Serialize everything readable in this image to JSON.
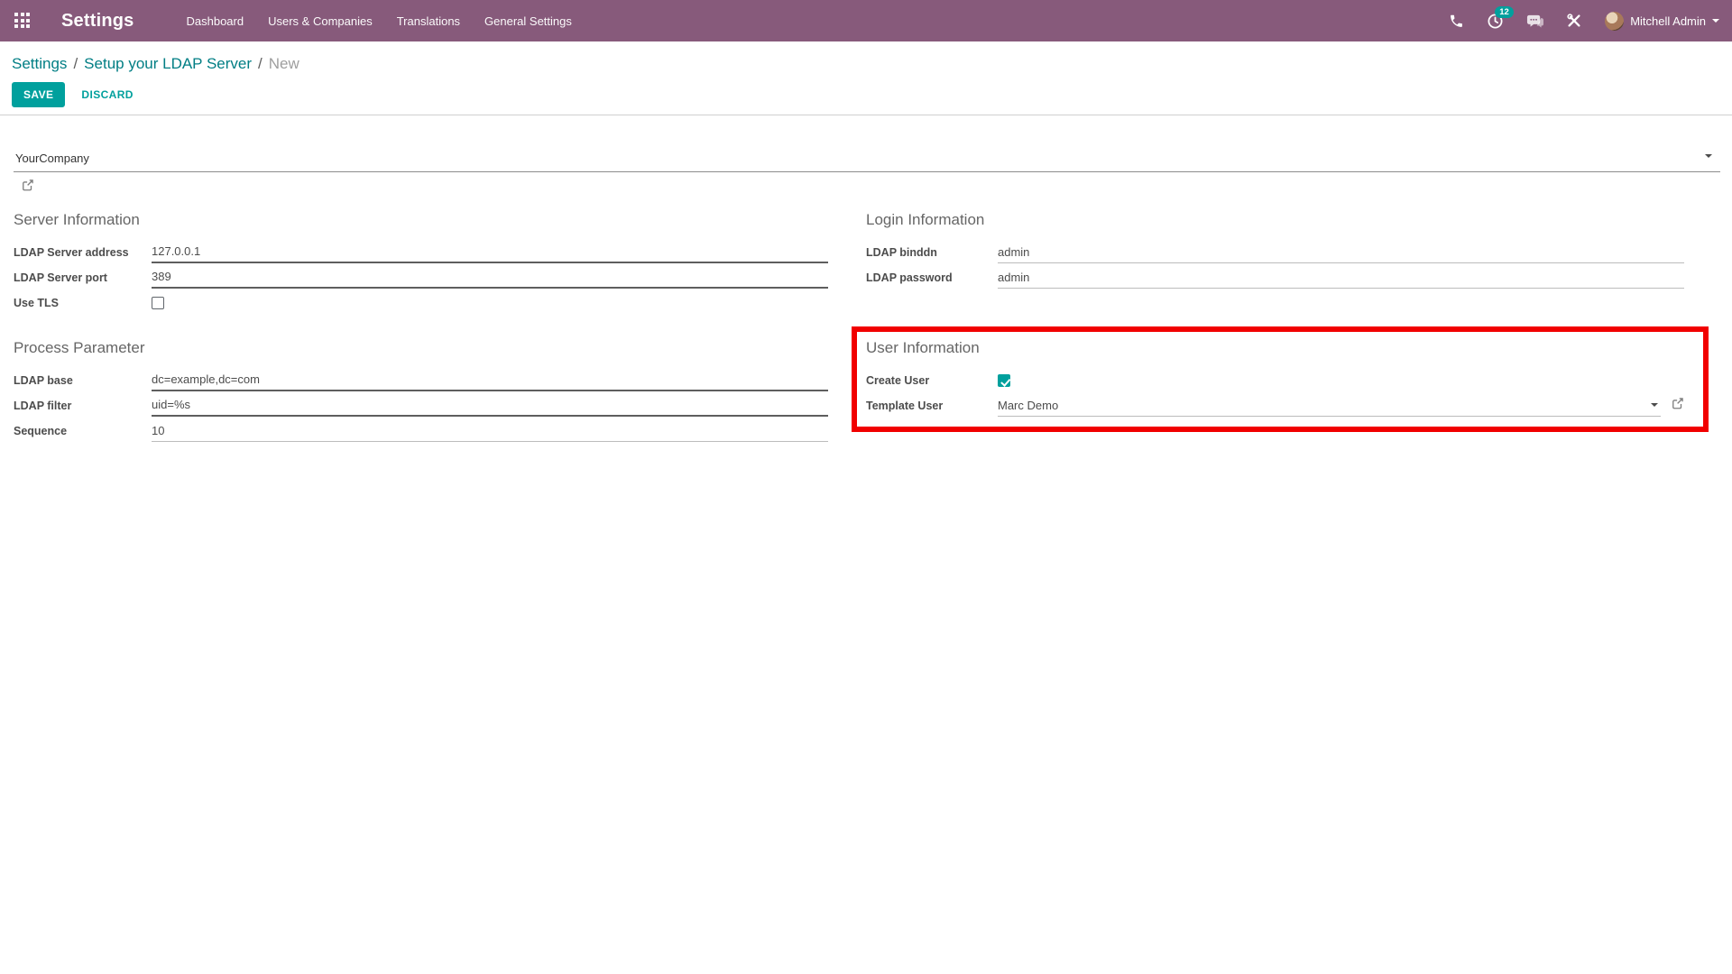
{
  "colors": {
    "header_bg": "#875A7B",
    "primary_teal": "#00A09D",
    "link_teal": "#017E84",
    "highlight_red": "#F10000"
  },
  "header": {
    "app_title": "Settings",
    "nav": [
      "Dashboard",
      "Users & Companies",
      "Translations",
      "General Settings"
    ],
    "systray": {
      "activity_count": "12",
      "user_name": "Mitchell Admin"
    }
  },
  "breadcrumb": {
    "links": [
      "Settings",
      "Setup your LDAP Server"
    ],
    "current": "New",
    "separator": "/"
  },
  "actions": {
    "save": "SAVE",
    "discard": "DISCARD"
  },
  "form": {
    "company": {
      "value": "YourCompany"
    },
    "sections": {
      "server_info": {
        "title": "Server Information",
        "fields": [
          {
            "label": "LDAP Server address",
            "value": "127.0.0.1"
          },
          {
            "label": "LDAP Server port",
            "value": "389"
          },
          {
            "label": "Use TLS",
            "checked": false
          }
        ]
      },
      "login_info": {
        "title": "Login Information",
        "fields": [
          {
            "label": "LDAP binddn",
            "value": "admin"
          },
          {
            "label": "LDAP password",
            "value": "admin"
          }
        ]
      },
      "process_param": {
        "title": "Process Parameter",
        "fields": [
          {
            "label": "LDAP base",
            "value": "dc=example,dc=com"
          },
          {
            "label": "LDAP filter",
            "value": "uid=%s"
          },
          {
            "label": "Sequence",
            "value": "10"
          }
        ]
      },
      "user_info": {
        "title": "User Information",
        "fields": [
          {
            "label": "Create User",
            "checked": true
          },
          {
            "label": "Template User",
            "value": "Marc Demo"
          }
        ]
      }
    }
  },
  "icons": {
    "apps": "grid-icon",
    "phone": "phone-icon",
    "activities": "clock-icon",
    "messages": "chat-icon",
    "tools": "tools-icon",
    "dropdowns": "caret-down-icon",
    "record_links": "external-link-icon"
  }
}
